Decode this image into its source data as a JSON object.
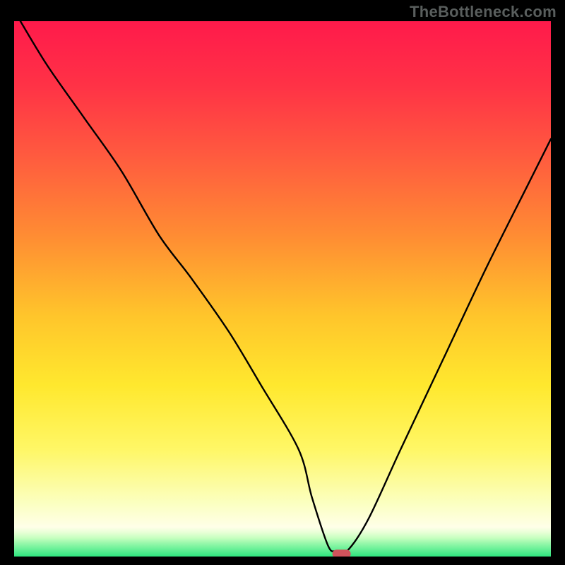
{
  "watermark": "TheBottleneck.com",
  "chart_data": {
    "type": "line",
    "title": "",
    "xlabel": "",
    "ylabel": "",
    "xlim": [
      0,
      100
    ],
    "ylim": [
      0,
      100
    ],
    "series": [
      {
        "name": "bottleneck-curve",
        "x": [
          0,
          6,
          13,
          20,
          27,
          33,
          40,
          46,
          53,
          55.5,
          58.5,
          60,
          62,
          66,
          72,
          80,
          88,
          96,
          100
        ],
        "y": [
          102,
          92,
          82,
          72,
          60,
          52,
          42,
          32,
          20,
          11,
          2,
          1,
          1,
          7,
          20,
          37,
          54,
          70,
          78
        ]
      }
    ],
    "marker": {
      "x": 61,
      "y": 0.5
    },
    "gradient_bands": [
      {
        "stop": 0.0,
        "color": "#ff1a4b"
      },
      {
        "stop": 0.12,
        "color": "#ff3246"
      },
      {
        "stop": 0.25,
        "color": "#ff5a3f"
      },
      {
        "stop": 0.4,
        "color": "#ff8c33"
      },
      {
        "stop": 0.55,
        "color": "#ffc52b"
      },
      {
        "stop": 0.68,
        "color": "#ffe82e"
      },
      {
        "stop": 0.8,
        "color": "#fff766"
      },
      {
        "stop": 0.9,
        "color": "#fbffc0"
      },
      {
        "stop": 0.945,
        "color": "#ffffe8"
      },
      {
        "stop": 0.955,
        "color": "#e8ffd6"
      },
      {
        "stop": 0.965,
        "color": "#c8ffc0"
      },
      {
        "stop": 0.975,
        "color": "#98f8ab"
      },
      {
        "stop": 1.0,
        "color": "#2ee67e"
      }
    ]
  }
}
